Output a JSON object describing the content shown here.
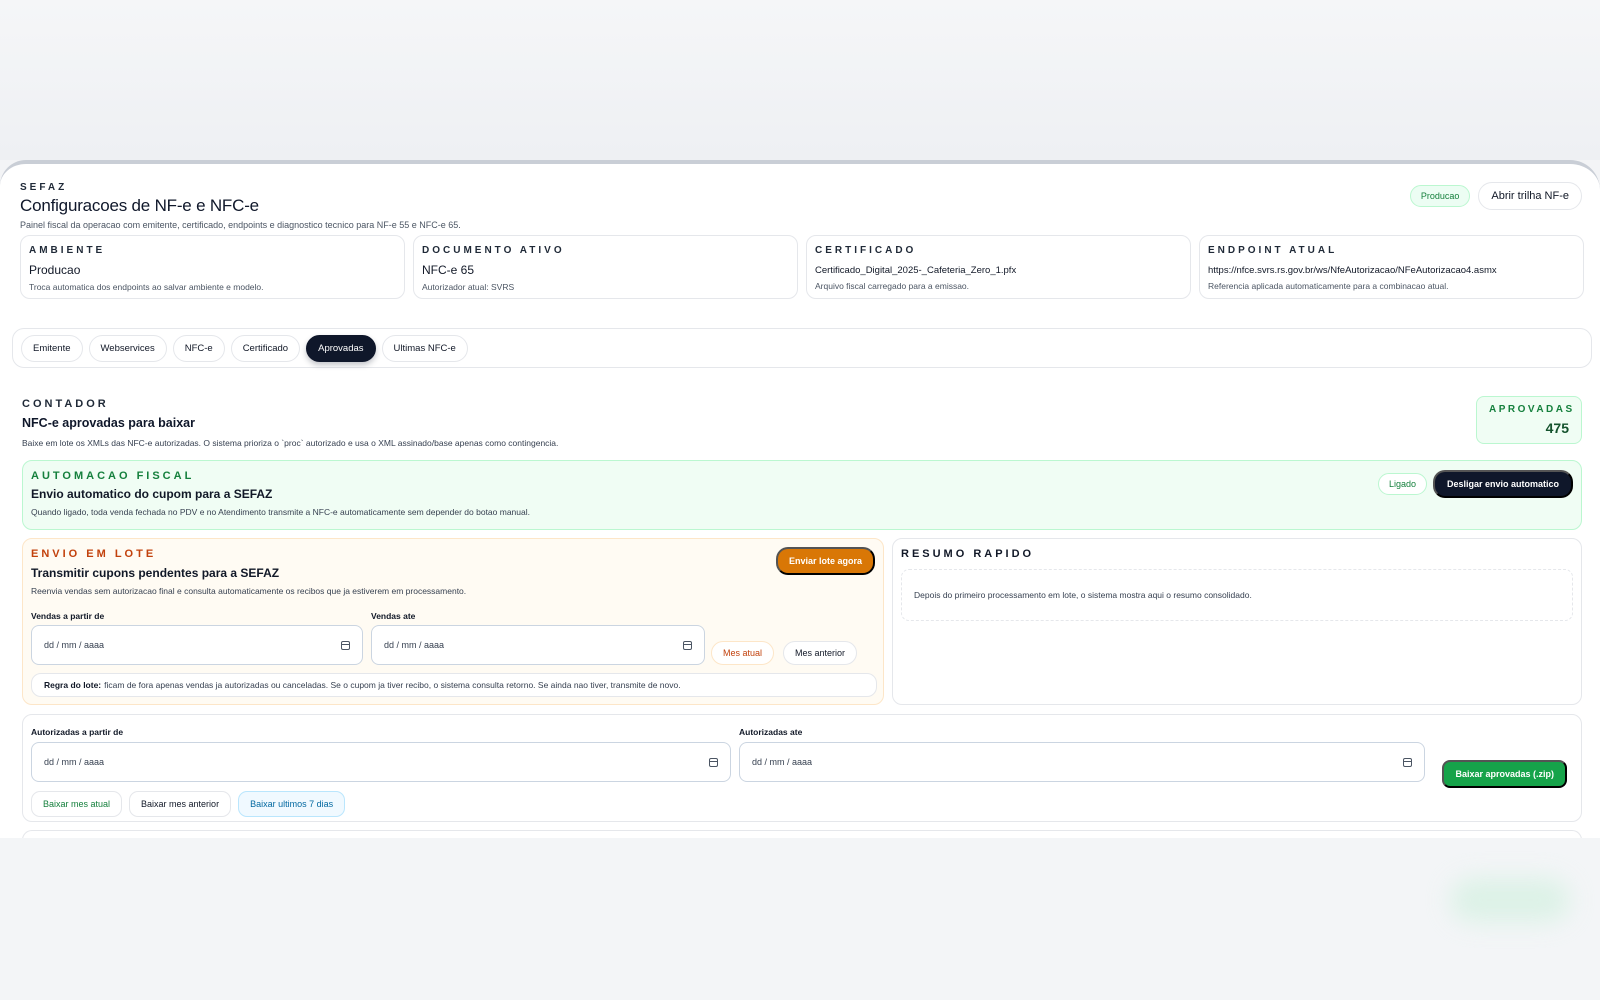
{
  "header": {
    "eyebrow": "SEFAZ",
    "title": "Configuracoes de NF-e e NFC-e",
    "subtitle": "Painel fiscal da operacao com emitente, certificado, endpoints e diagnostico tecnico para NF-e 55 e NFC-e 65.",
    "environment_badge": "Producao",
    "action_button": "Abrir trilha NF-e"
  },
  "cards": [
    {
      "label": "AMBIENTE",
      "value": "Producao",
      "description": "Troca automatica dos endpoints ao salvar ambiente e modelo."
    },
    {
      "label": "DOCUMENTO ATIVO",
      "value": "NFC-e 65",
      "description": "Autorizador atual: SVRS"
    },
    {
      "label": "CERTIFICADO",
      "value": "Certificado_Digital_2025-_Cafeteria_Zero_1.pfx",
      "description": "Arquivo fiscal carregado para a emissao."
    },
    {
      "label": "ENDPOINT ATUAL",
      "value": "https://nfce.svrs.rs.gov.br/ws/NfeAutorizacao/NFeAutorizacao4.asmx",
      "description": "Referencia aplicada automaticamente para a combinacao atual."
    }
  ],
  "tabs": [
    {
      "label": "Emitente"
    },
    {
      "label": "Webservices"
    },
    {
      "label": "NFC-e"
    },
    {
      "label": "Certificado"
    },
    {
      "label": "Aprovadas",
      "active": true
    },
    {
      "label": "Ultimas NFC-e"
    }
  ],
  "section": {
    "eyebrow": "CONTADOR",
    "title": "NFC-e aprovadas para baixar",
    "description": "Baixe em lote os XMLs das NFC-e autorizadas. O sistema prioriza o `proc` autorizado e usa o XML assinado/base apenas como contingencia.",
    "counter_label": "APROVADAS",
    "counter_value": "475"
  },
  "automation": {
    "eyebrow": "AUTOMACAO FISCAL",
    "title": "Envio automatico do cupom para a SEFAZ",
    "description": "Quando ligado, toda venda fechada no PDV e no Atendimento transmite a NFC-e automaticamente sem depender do botao manual.",
    "status": "Ligado",
    "toggle_button": "Desligar envio automatico"
  },
  "batch": {
    "eyebrow": "ENVIO EM LOTE",
    "title": "Transmitir cupons pendentes para a SEFAZ",
    "description": "Reenvia vendas sem autorizacao final e consulta automaticamente os recibos que ja estiverem em processamento.",
    "send_button": "Enviar lote agora",
    "from_label": "Vendas a partir de",
    "to_label": "Vendas ate",
    "date_placeholder": "dd / mm / aaaa",
    "current_month_button": "Mes atual",
    "previous_month_button": "Mes anterior",
    "rule_label": "Regra do lote:",
    "rule_text": "ficam de fora apenas vendas ja autorizadas ou canceladas. Se o cupom ja tiver recibo, o sistema consulta retorno. Se ainda nao tiver, transmite de novo."
  },
  "summary": {
    "eyebrow": "RESUMO RAPIDO",
    "text": "Depois do primeiro processamento em lote, o sistema mostra aqui o resumo consolidado."
  },
  "downloads": {
    "from_label": "Autorizadas a partir de",
    "to_label": "Autorizadas ate",
    "date_placeholder": "dd / mm / aaaa",
    "download_button": "Baixar aprovadas (.zip)",
    "current_month_button": "Baixar mes atual",
    "previous_month_button": "Baixar mes anterior",
    "last_7_days_button": "Baixar ultimos 7 dias"
  },
  "colors": {
    "dark": "#0f172a",
    "green": "#16a34a",
    "orange": "#d97706",
    "blue": "#0369a1"
  }
}
